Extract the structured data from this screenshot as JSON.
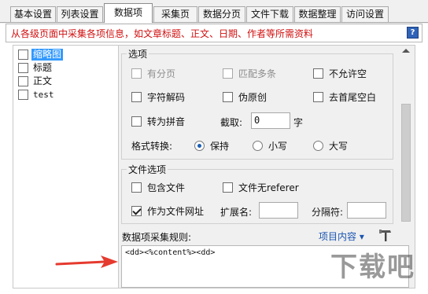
{
  "tabs": [
    "基本设置",
    "列表设置",
    "数据项",
    "采集页",
    "数据分页",
    "文件下载",
    "数据整理",
    "访问设置"
  ],
  "active_tab": "数据项",
  "info_text": "从各级页面中采集各项信息，如文章标题、正文、日期、作者等所需资料",
  "help_icon_glyph": "?",
  "tree": {
    "items": [
      {
        "label": "缩略图",
        "selected": true
      },
      {
        "label": "标题",
        "selected": false
      },
      {
        "label": "正文",
        "selected": false
      },
      {
        "label": "test",
        "selected": false
      }
    ]
  },
  "options": {
    "title": "选项",
    "row1": {
      "c1": "有分页",
      "c2": "匹配多条",
      "c3": "不允许空"
    },
    "row2": {
      "c1": "字符解码",
      "c2": "伪原创",
      "c3": "去首尾空白"
    },
    "row3": {
      "c1": "转为拼音",
      "extract_label": "截取:",
      "extract_value": "0",
      "extract_unit": "字"
    },
    "format": {
      "label": "格式转换:",
      "keep": "保持",
      "lower": "小写",
      "upper": "大写"
    }
  },
  "file_options": {
    "title": "文件选项",
    "contains_file": "包含文件",
    "no_referer": "文件无referer",
    "as_url": "作为文件网址",
    "ext_label": "扩展名:",
    "ext_value": "",
    "sep_label": "分隔符:",
    "sep_value": ""
  },
  "rule": {
    "label": "数据项采集规则:",
    "link": "项目内容 ▾",
    "content": "<dd><%content%><dd>"
  },
  "watermark": "下载吧",
  "colors": {
    "info_text": "#d01010",
    "link": "#1a55b0",
    "selection": "#3399ff",
    "arrow": "#e53a2e"
  }
}
